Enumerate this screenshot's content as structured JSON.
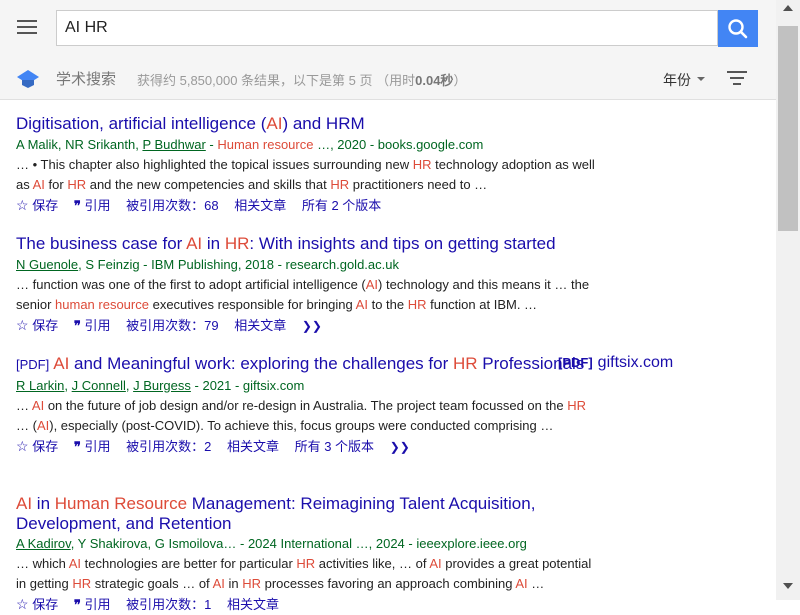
{
  "header": {
    "menu_icon": "hamburger-menu-icon",
    "search_value": "AI HR",
    "search_icon": "search-icon"
  },
  "subheader": {
    "logo_icon": "scholar-cap-icon",
    "title": "学术搜索",
    "stats_prefix": "获得约 5,850,000 条结果，以下是第 5 页 （用时",
    "stats_time": "0.04秒",
    "stats_suffix": "）",
    "year_label": "年份",
    "filter_icon": "filter-lines-icon"
  },
  "results": [
    {
      "title_parts": [
        {
          "t": "Digitisation, artificial intelligence (",
          "h": false
        },
        {
          "t": "AI",
          "h": true
        },
        {
          "t": ") and HRM",
          "h": false
        }
      ],
      "authors_parts": [
        {
          "t": "A Malik, NR Srikanth, ",
          "link": false
        },
        {
          "t": "P Budhwar",
          "link": true
        },
        {
          "t": " - ",
          "link": false
        },
        {
          "t": "Human resource",
          "hl": true
        },
        {
          "t": " …, 2020 - books.google.com",
          "link": false
        }
      ],
      "snippet_parts": [
        {
          "t": "… • This chapter also highlighted the topical issues surrounding new ",
          "h": false
        },
        {
          "t": "HR",
          "h": true
        },
        {
          "t": " technology adoption as well as ",
          "h": false
        },
        {
          "t": "AI",
          "h": true
        },
        {
          "t": " for ",
          "h": false
        },
        {
          "t": "HR",
          "h": true
        },
        {
          "t": " and the new competencies and skills that ",
          "h": false
        },
        {
          "t": "HR",
          "h": true
        },
        {
          "t": " practitioners need to …",
          "h": false
        }
      ],
      "save": "保存",
      "cite": "引用",
      "cited_by": "被引用次数：68",
      "related": "相关文章",
      "versions": "所有 2 个版本"
    },
    {
      "title_parts": [
        {
          "t": "The business case for ",
          "h": false
        },
        {
          "t": "AI",
          "h": true
        },
        {
          "t": " in ",
          "h": false
        },
        {
          "t": "HR",
          "h": true
        },
        {
          "t": ": With insights and tips on getting started",
          "h": false
        }
      ],
      "authors_parts": [
        {
          "t": "N Guenole",
          "link": true
        },
        {
          "t": ", S Feinzig - IBM Publishing, 2018 - research.gold.ac.uk",
          "link": false
        }
      ],
      "snippet_parts": [
        {
          "t": "… function was one of the first to adopt artificial intelligence (",
          "h": false
        },
        {
          "t": "AI",
          "h": true
        },
        {
          "t": ") technology and this means it … the senior ",
          "h": false
        },
        {
          "t": "human resource",
          "h": true
        },
        {
          "t": " executives responsible for bringing ",
          "h": false
        },
        {
          "t": "AI",
          "h": true
        },
        {
          "t": " to the ",
          "h": false
        },
        {
          "t": "HR",
          "h": true
        },
        {
          "t": " function at IBM. …",
          "h": false
        }
      ],
      "save": "保存",
      "cite": "引用",
      "cited_by": "被引用次数：79",
      "related": "相关文章",
      "versions": ""
    },
    {
      "pdf_tag": "[PDF]",
      "title_parts": [
        {
          "t": "AI",
          "h": true
        },
        {
          "t": " and Meaningful work: exploring the challenges for ",
          "h": false
        },
        {
          "t": "HR",
          "h": true
        },
        {
          "t": " Professionals",
          "h": false
        }
      ],
      "side_pdf": "[PDF]",
      "side_domain": "giftsix.com",
      "authors_parts": [
        {
          "t": "R Larkin",
          "link": true
        },
        {
          "t": ", ",
          "link": false
        },
        {
          "t": "J Connell",
          "link": true
        },
        {
          "t": ", ",
          "link": false
        },
        {
          "t": "J Burgess",
          "link": true
        },
        {
          "t": " - 2021 - giftsix.com",
          "link": false
        }
      ],
      "snippet_parts": [
        {
          "t": "… ",
          "h": false
        },
        {
          "t": "AI",
          "h": true
        },
        {
          "t": " on the future of job design and/or re-design in Australia. The project team focussed on the ",
          "h": false
        },
        {
          "t": "HR",
          "h": true
        },
        {
          "t": " … (",
          "h": false
        },
        {
          "t": "AI",
          "h": true
        },
        {
          "t": "), especially (post-COVID). To achieve this, focus groups were conducted comprising …",
          "h": false
        }
      ],
      "save": "保存",
      "cite": "引用",
      "cited_by": "被引用次数：2",
      "related": "相关文章",
      "versions": "所有 3 个版本"
    },
    {
      "title_parts": [
        {
          "t": "AI",
          "h": true
        },
        {
          "t": " in ",
          "h": false
        },
        {
          "t": "Human Resource",
          "h": true
        },
        {
          "t": " Management: Reimagining Talent Acquisition, Development, and Retention",
          "h": false
        }
      ],
      "authors_parts": [
        {
          "t": "A Kadirov",
          "link": true
        },
        {
          "t": ", Y Shakirova, G Ismoilova… - 2024 International …, 2024 - ieeexplore.ieee.org",
          "link": false
        }
      ],
      "snippet_parts": [
        {
          "t": "… which ",
          "h": false
        },
        {
          "t": "AI",
          "h": true
        },
        {
          "t": " technologies are better for particular ",
          "h": false
        },
        {
          "t": "HR",
          "h": true
        },
        {
          "t": " activities like, … of ",
          "h": false
        },
        {
          "t": "AI",
          "h": true
        },
        {
          "t": " provides a great potential in getting ",
          "h": false
        },
        {
          "t": "HR",
          "h": true
        },
        {
          "t": " strategic goals … of ",
          "h": false
        },
        {
          "t": "AI",
          "h": true
        },
        {
          "t": " in ",
          "h": false
        },
        {
          "t": "HR",
          "h": true
        },
        {
          "t": " processes favoring an approach combining ",
          "h": false
        },
        {
          "t": "AI",
          "h": true
        },
        {
          "t": " …",
          "h": false
        }
      ],
      "save": "保存",
      "cite": "引用",
      "cited_by": "被引用次数：1",
      "related": "相关文章",
      "versions": ""
    }
  ],
  "colors": {
    "link": "#1a0dab",
    "highlight": "#dd4b39",
    "green": "#006621",
    "search_button": "#4285f4"
  }
}
